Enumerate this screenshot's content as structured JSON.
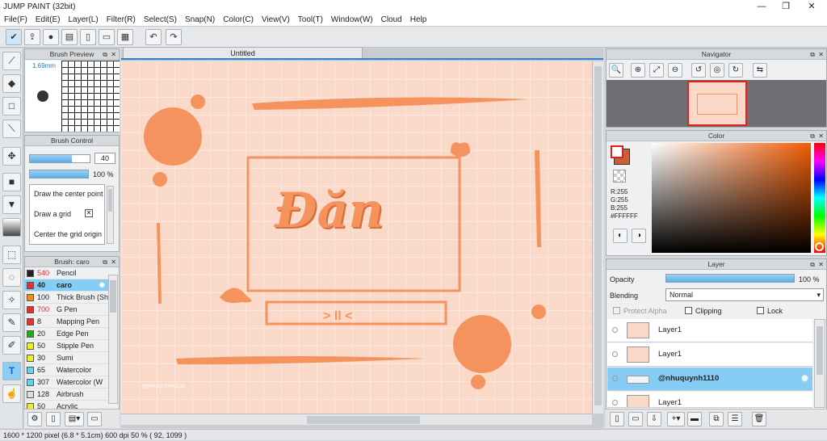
{
  "window": {
    "title": "JUMP PAINT (32bit)",
    "minimize": "—",
    "maximize": "❐",
    "close": "✕"
  },
  "menu": [
    "File(F)",
    "Edit(E)",
    "Layer(L)",
    "Filter(R)",
    "Select(S)",
    "Snap(N)",
    "Color(C)",
    "View(V)",
    "Tool(T)",
    "Window(W)",
    "Cloud",
    "Help"
  ],
  "brush_preview": {
    "title": "Brush Preview",
    "size": "1.69mm"
  },
  "brush_control": {
    "title": "Brush Control",
    "width_value": "40",
    "width_fill": 0.7,
    "opacity_value": "100 %",
    "opacity_fill": 1.0,
    "options": [
      "Draw the center point",
      "Draw a grid",
      "Center the grid origin"
    ]
  },
  "brush_list": {
    "title": "Brush: caro",
    "items": [
      {
        "size": "540",
        "name": "Pencil",
        "color": "#222222",
        "red": true
      },
      {
        "size": "40",
        "name": "caro",
        "color": "#e53030",
        "selected": true
      },
      {
        "size": "100",
        "name": "Thick Brush (Sh",
        "color": "#f08a1a"
      },
      {
        "size": "700",
        "name": "G Pen",
        "color": "#e53030",
        "red": true
      },
      {
        "size": "8",
        "name": "Mapping Pen",
        "color": "#e53030"
      },
      {
        "size": "20",
        "name": "Edge Pen",
        "color": "#22aa22"
      },
      {
        "size": "50",
        "name": "Stipple Pen",
        "color": "#eeee30"
      },
      {
        "size": "30",
        "name": "Sumi",
        "color": "#eeee30"
      },
      {
        "size": "65",
        "name": "Watercolor",
        "color": "#6ad0ee"
      },
      {
        "size": "307",
        "name": "Watercolor (W",
        "color": "#6ad0ee"
      },
      {
        "size": "128",
        "name": "Airbrush",
        "color": "#dddddd"
      },
      {
        "size": "50",
        "name": "Acrylic",
        "color": "#eeee30"
      }
    ]
  },
  "document": {
    "tab": "Untitled",
    "lettering": "Đăn",
    "watermark": "@NHUQUYNH1110"
  },
  "navigator": {
    "title": "Navigator"
  },
  "color": {
    "title": "Color",
    "r": "R:255",
    "g": "G:255",
    "b": "B:255",
    "hex": "#FFFFFF"
  },
  "layer": {
    "title": "Layer",
    "opacity_label": "Opacity",
    "opacity_value": "100 %",
    "blending_label": "Blending",
    "blending_value": "Normal",
    "protect_alpha": "Protect Alpha",
    "clipping": "Clipping",
    "lock": "Lock",
    "layers": [
      {
        "name": "Layer1"
      },
      {
        "name": "Layer1"
      },
      {
        "name": "@nhuquynh1110",
        "selected": true
      },
      {
        "name": "Layer1"
      }
    ]
  },
  "status": {
    "text": "1600 * 1200 pixel   (6.8 * 5.1cm)   600 dpi   50 %   ( 92, 1099 )"
  },
  "colors": {
    "accent": "#f5935e",
    "peach_bg": "#fbd9c8",
    "selection": "#86cdf5"
  }
}
